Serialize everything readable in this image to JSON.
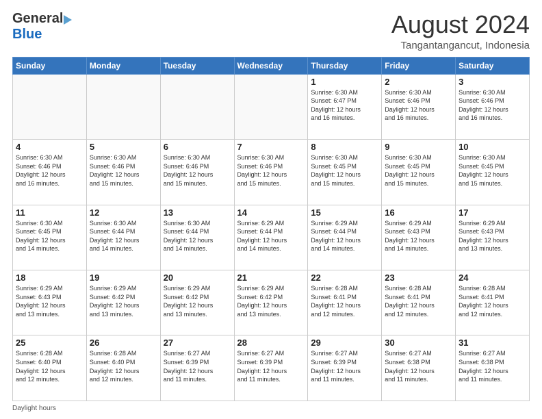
{
  "header": {
    "logo_general": "General",
    "logo_blue": "Blue",
    "month_year": "August 2024",
    "location": "Tangantangancut, Indonesia"
  },
  "footer": {
    "daylight_label": "Daylight hours"
  },
  "days_of_week": [
    "Sunday",
    "Monday",
    "Tuesday",
    "Wednesday",
    "Thursday",
    "Friday",
    "Saturday"
  ],
  "weeks": [
    [
      {
        "day": "",
        "info": ""
      },
      {
        "day": "",
        "info": ""
      },
      {
        "day": "",
        "info": ""
      },
      {
        "day": "",
        "info": ""
      },
      {
        "day": "1",
        "info": "Sunrise: 6:30 AM\nSunset: 6:47 PM\nDaylight: 12 hours\nand 16 minutes."
      },
      {
        "day": "2",
        "info": "Sunrise: 6:30 AM\nSunset: 6:46 PM\nDaylight: 12 hours\nand 16 minutes."
      },
      {
        "day": "3",
        "info": "Sunrise: 6:30 AM\nSunset: 6:46 PM\nDaylight: 12 hours\nand 16 minutes."
      }
    ],
    [
      {
        "day": "4",
        "info": "Sunrise: 6:30 AM\nSunset: 6:46 PM\nDaylight: 12 hours\nand 16 minutes."
      },
      {
        "day": "5",
        "info": "Sunrise: 6:30 AM\nSunset: 6:46 PM\nDaylight: 12 hours\nand 15 minutes."
      },
      {
        "day": "6",
        "info": "Sunrise: 6:30 AM\nSunset: 6:46 PM\nDaylight: 12 hours\nand 15 minutes."
      },
      {
        "day": "7",
        "info": "Sunrise: 6:30 AM\nSunset: 6:46 PM\nDaylight: 12 hours\nand 15 minutes."
      },
      {
        "day": "8",
        "info": "Sunrise: 6:30 AM\nSunset: 6:45 PM\nDaylight: 12 hours\nand 15 minutes."
      },
      {
        "day": "9",
        "info": "Sunrise: 6:30 AM\nSunset: 6:45 PM\nDaylight: 12 hours\nand 15 minutes."
      },
      {
        "day": "10",
        "info": "Sunrise: 6:30 AM\nSunset: 6:45 PM\nDaylight: 12 hours\nand 15 minutes."
      }
    ],
    [
      {
        "day": "11",
        "info": "Sunrise: 6:30 AM\nSunset: 6:45 PM\nDaylight: 12 hours\nand 14 minutes."
      },
      {
        "day": "12",
        "info": "Sunrise: 6:30 AM\nSunset: 6:44 PM\nDaylight: 12 hours\nand 14 minutes."
      },
      {
        "day": "13",
        "info": "Sunrise: 6:30 AM\nSunset: 6:44 PM\nDaylight: 12 hours\nand 14 minutes."
      },
      {
        "day": "14",
        "info": "Sunrise: 6:29 AM\nSunset: 6:44 PM\nDaylight: 12 hours\nand 14 minutes."
      },
      {
        "day": "15",
        "info": "Sunrise: 6:29 AM\nSunset: 6:44 PM\nDaylight: 12 hours\nand 14 minutes."
      },
      {
        "day": "16",
        "info": "Sunrise: 6:29 AM\nSunset: 6:43 PM\nDaylight: 12 hours\nand 14 minutes."
      },
      {
        "day": "17",
        "info": "Sunrise: 6:29 AM\nSunset: 6:43 PM\nDaylight: 12 hours\nand 13 minutes."
      }
    ],
    [
      {
        "day": "18",
        "info": "Sunrise: 6:29 AM\nSunset: 6:43 PM\nDaylight: 12 hours\nand 13 minutes."
      },
      {
        "day": "19",
        "info": "Sunrise: 6:29 AM\nSunset: 6:42 PM\nDaylight: 12 hours\nand 13 minutes."
      },
      {
        "day": "20",
        "info": "Sunrise: 6:29 AM\nSunset: 6:42 PM\nDaylight: 12 hours\nand 13 minutes."
      },
      {
        "day": "21",
        "info": "Sunrise: 6:29 AM\nSunset: 6:42 PM\nDaylight: 12 hours\nand 13 minutes."
      },
      {
        "day": "22",
        "info": "Sunrise: 6:28 AM\nSunset: 6:41 PM\nDaylight: 12 hours\nand 12 minutes."
      },
      {
        "day": "23",
        "info": "Sunrise: 6:28 AM\nSunset: 6:41 PM\nDaylight: 12 hours\nand 12 minutes."
      },
      {
        "day": "24",
        "info": "Sunrise: 6:28 AM\nSunset: 6:41 PM\nDaylight: 12 hours\nand 12 minutes."
      }
    ],
    [
      {
        "day": "25",
        "info": "Sunrise: 6:28 AM\nSunset: 6:40 PM\nDaylight: 12 hours\nand 12 minutes."
      },
      {
        "day": "26",
        "info": "Sunrise: 6:28 AM\nSunset: 6:40 PM\nDaylight: 12 hours\nand 12 minutes."
      },
      {
        "day": "27",
        "info": "Sunrise: 6:27 AM\nSunset: 6:39 PM\nDaylight: 12 hours\nand 11 minutes."
      },
      {
        "day": "28",
        "info": "Sunrise: 6:27 AM\nSunset: 6:39 PM\nDaylight: 12 hours\nand 11 minutes."
      },
      {
        "day": "29",
        "info": "Sunrise: 6:27 AM\nSunset: 6:39 PM\nDaylight: 12 hours\nand 11 minutes."
      },
      {
        "day": "30",
        "info": "Sunrise: 6:27 AM\nSunset: 6:38 PM\nDaylight: 12 hours\nand 11 minutes."
      },
      {
        "day": "31",
        "info": "Sunrise: 6:27 AM\nSunset: 6:38 PM\nDaylight: 12 hours\nand 11 minutes."
      }
    ]
  ]
}
